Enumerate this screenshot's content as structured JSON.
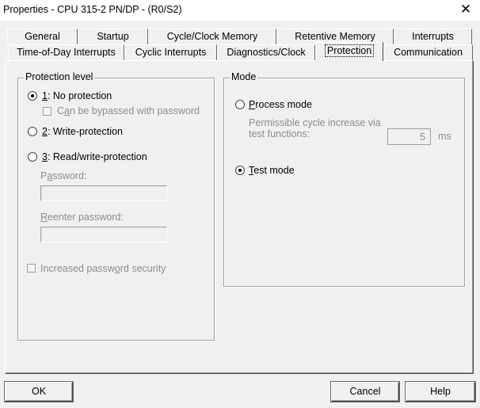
{
  "window": {
    "title": "Properties - CPU 315-2 PN/DP - (R0/S2)",
    "close_glyph": "✕"
  },
  "tabs": {
    "row1": [
      "General",
      "Startup",
      "Cycle/Clock Memory",
      "Retentive Memory",
      "Interrupts"
    ],
    "row2": [
      "Time-of-Day Interrupts",
      "Cyclic Interrupts",
      "Diagnostics/Clock",
      "Protection",
      "Communication"
    ],
    "active": "Protection"
  },
  "protection_level": {
    "legend": "Protection level",
    "no_protection": {
      "mnemonic": "1",
      "rest": ": No protection",
      "checked": true
    },
    "bypass": {
      "pre": "C",
      "mnemonic": "a",
      "rest": "n be bypassed with password",
      "checked": false
    },
    "write_protection": {
      "mnemonic": "2",
      "rest": ": Write-protection",
      "checked": false
    },
    "read_write_protection": {
      "mnemonic": "3",
      "rest": ": Read/write-protection",
      "checked": false
    },
    "password_label": {
      "pre": "P",
      "mnemonic": "a",
      "rest": "ssword:"
    },
    "password_value": "",
    "reenter_label": {
      "pre": "",
      "mnemonic": "R",
      "rest": "eenter password:"
    },
    "reenter_value": "",
    "increased_security": {
      "pre": "Increased passw",
      "mnemonic": "o",
      "rest": "rd security",
      "checked": false
    }
  },
  "mode": {
    "legend": "Mode",
    "process_mode": {
      "mnemonic": "P",
      "rest": "rocess mode",
      "checked": false
    },
    "cycle_line1": "Permissible  cycle increase via",
    "cycle_line2": "test functions:",
    "cycle_value": "5",
    "cycle_unit": "ms",
    "test_mode": {
      "mnemonic": "T",
      "rest": "est mode",
      "checked": true
    }
  },
  "buttons": {
    "ok": "OK",
    "cancel": "Cancel",
    "help": "Help"
  }
}
